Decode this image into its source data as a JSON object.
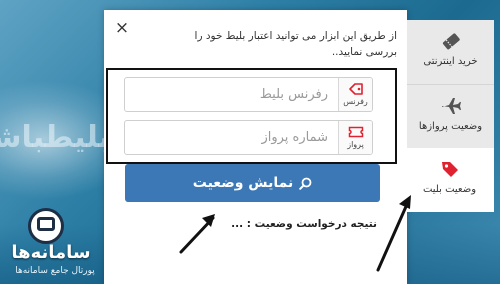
{
  "background": {
    "watermark_text": "بلیطباشگ"
  },
  "logo": {
    "name": "سامانه‌ها",
    "subtitle": "پورتال جامع سامانه‌ها"
  },
  "dialog": {
    "close_label": "×",
    "intro": "از طریق این ابزار می توانید اعتبار بلیط خود را بررسی نمایید..",
    "fields": [
      {
        "placeholder": "رفرنس بلیط",
        "addon_label": "رفرنس",
        "icon": "tag-icon"
      },
      {
        "placeholder": "شماره پرواز",
        "addon_label": "پرواز",
        "icon": "ticket-icon"
      }
    ],
    "submit_label": "نمایش وضعیت",
    "result_label": "نتیجه درخواست وضعیت : ..."
  },
  "tabs": [
    {
      "label": "خرید اینترنتی",
      "icon": "ticket-stub-icon",
      "active": false
    },
    {
      "label": "وضعیت پروازها",
      "icon": "airplane-icon",
      "active": false
    },
    {
      "label": "وضعیت بلیت",
      "icon": "tag-icon",
      "active": true
    }
  ],
  "colors": {
    "accent": "#3c78b5",
    "tag_red": "#e0212f",
    "tab_bg": "#e9e9e9"
  }
}
